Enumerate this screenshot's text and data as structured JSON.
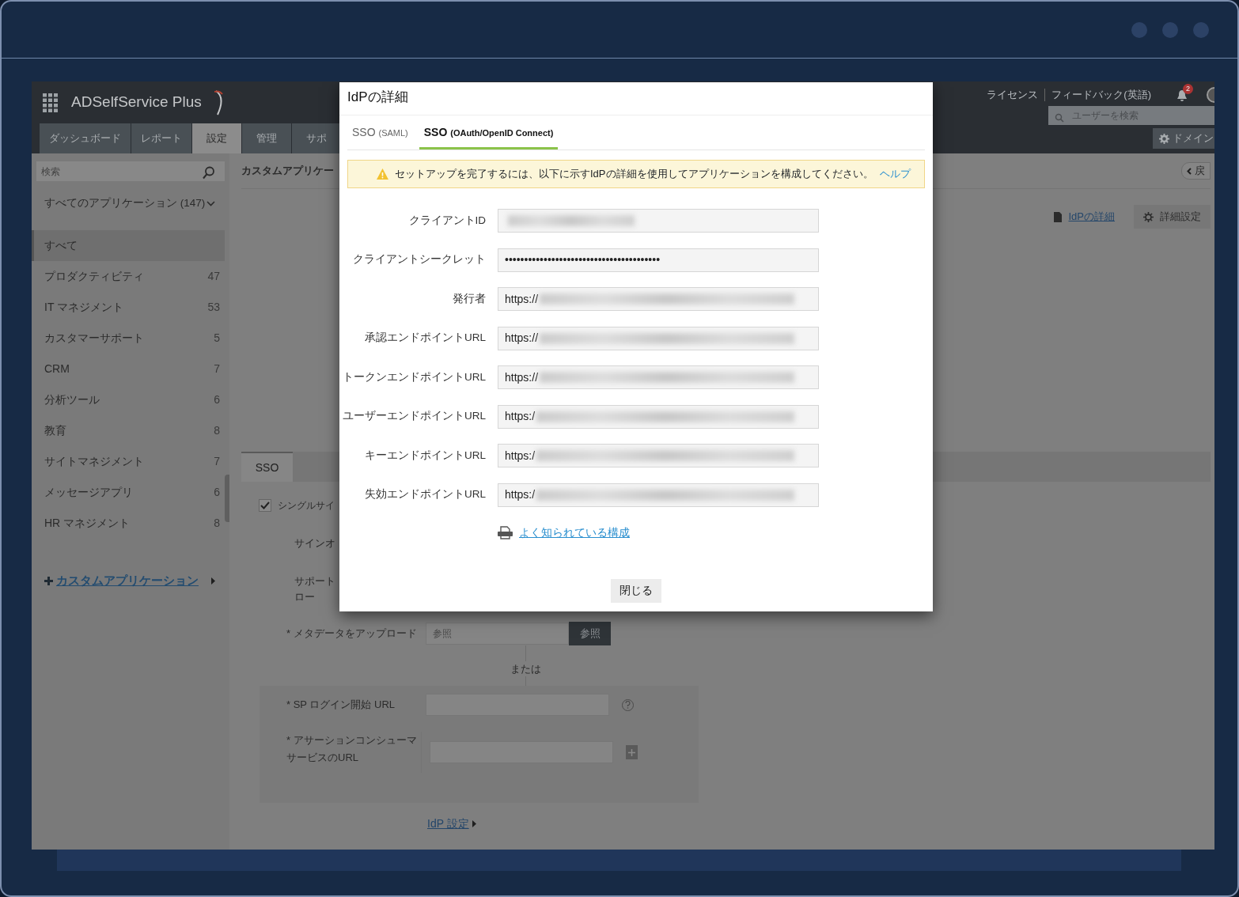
{
  "app": {
    "logo": "ADSelfService Plus",
    "header_links": [
      "ライセンス",
      "フィードバック(英語)"
    ],
    "notification_count": "2",
    "user_search": {
      "placeholder": "ユーザーを検索"
    },
    "domain_button": "ドメイン",
    "nav_tabs": [
      {
        "label": "ダッシュボード",
        "selected": false
      },
      {
        "label": "レポート",
        "selected": false
      },
      {
        "label": "設定",
        "selected": true
      },
      {
        "label": "管理",
        "selected": false
      },
      {
        "label": "サポ",
        "selected": false
      }
    ]
  },
  "sidebar": {
    "search": {
      "placeholder": "検索"
    },
    "filter": "すべてのアプリケーション (147)",
    "categories": [
      {
        "label": "すべて",
        "selected": true
      },
      {
        "label": "プロダクティビティ",
        "count": "47",
        "selected": false
      },
      {
        "label": "IT マネジメント",
        "count": "53",
        "selected": false
      },
      {
        "label": "カスタマーサポート",
        "count": "5",
        "selected": false
      },
      {
        "label": "CRM",
        "count": "7",
        "selected": false
      },
      {
        "label": "分析ツール",
        "count": "6",
        "selected": false
      },
      {
        "label": "教育",
        "count": "8",
        "selected": false
      },
      {
        "label": "サイトマネジメント",
        "count": "7",
        "selected": false
      },
      {
        "label": "メッセージアプリ",
        "count": "6",
        "selected": false
      },
      {
        "label": "HR マネジメント",
        "count": "8",
        "selected": false
      }
    ],
    "add_link": "カスタムアプリケーション"
  },
  "main": {
    "title": "カスタムアプリケー",
    "back_button": "戻",
    "idp_link": "IdPの詳細",
    "advanced_button": "詳細設定",
    "panel_tabs": [
      {
        "label": "SSO",
        "selected": true
      }
    ],
    "sso_checkbox": {
      "label": "シングルサイ",
      "checked": true
    },
    "partial_labels": [
      "サインオ",
      "サポート",
      "ロー"
    ],
    "metadata": {
      "label": "* メタデータをアップロード",
      "placeholder": "参照",
      "button": "参照"
    },
    "or_text": "または",
    "sp_login": {
      "label": "* SP ログイン開始 URL"
    },
    "acs": {
      "label": "* アサーションコンシューマサービスのURL"
    },
    "idp_settings_link": "IdP 設定"
  },
  "dialog": {
    "title": "IdPの詳細",
    "tabs": [
      {
        "label": "SSO",
        "note": "(SAML)",
        "selected": false
      },
      {
        "label": "SSO",
        "note": "(OAuth/OpenID Connect)",
        "selected": true
      }
    ],
    "alert": {
      "text": "セットアップを完了するには、以下に示すIdPの詳細を使用してアプリケーションを構成してください。",
      "link": "ヘルプ"
    },
    "fields": [
      {
        "label": "クライアントID",
        "blurred": true
      },
      {
        "label": "クライアントシークレット",
        "value": "••••••••••••••••••••••••••••••••••••••••",
        "blurred": false
      },
      {
        "label": "発行者",
        "value": "https://",
        "blurred": true
      },
      {
        "label": "承認エンドポイントURL",
        "value": "https://",
        "blurred": true
      },
      {
        "label": "トークンエンドポイントURL",
        "value": "https://",
        "blurred": true
      },
      {
        "label": "ユーザーエンドポイントURL",
        "value": "https:/",
        "blurred": true
      },
      {
        "label": "キーエンドポイントURL",
        "value": "https:/",
        "blurred": true
      },
      {
        "label": "失効エンドポイントURL",
        "value": "https:/",
        "blurred": true
      }
    ],
    "link": "よく知られている構成",
    "close_button": "閉じる"
  }
}
